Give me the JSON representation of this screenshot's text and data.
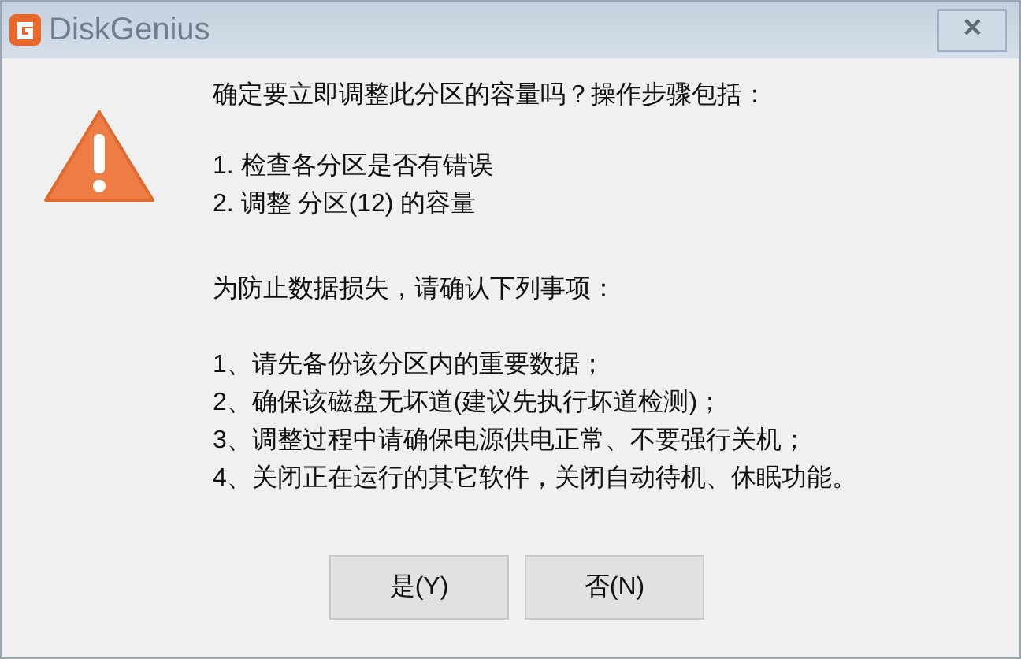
{
  "window": {
    "title": "DiskGenius",
    "close_label": "✕"
  },
  "message": {
    "heading": "确定要立即调整此分区的容量吗？操作步骤包括：",
    "steps": [
      "1. 检查各分区是否有错误",
      "2. 调整 分区(12) 的容量"
    ],
    "notice": "为防止数据损失，请确认下列事项：",
    "items": [
      "1、请先备份该分区内的重要数据；",
      "2、确保该磁盘无坏道(建议先执行坏道检测)；",
      "3、调整过程中请确保电源供电正常、不要强行关机；",
      "4、关闭正在运行的其它软件，关闭自动待机、休眠功能。"
    ]
  },
  "buttons": [
    {
      "label": "是(Y)"
    },
    {
      "label": "否(N)"
    }
  ]
}
